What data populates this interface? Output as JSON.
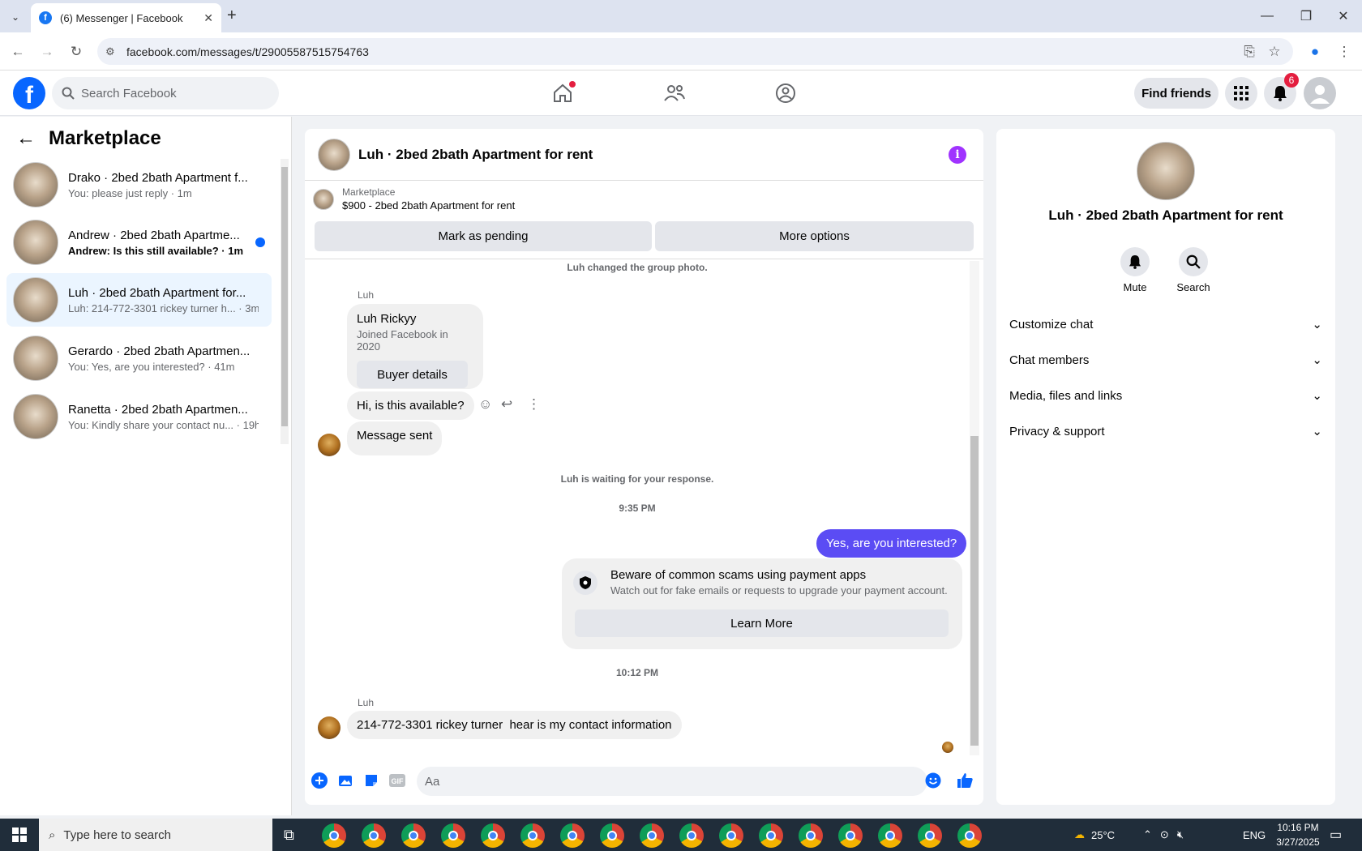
{
  "browser": {
    "tab_title": "(6) Messenger | Facebook",
    "url": "facebook.com/messages/t/29005587515754763"
  },
  "header": {
    "search_placeholder": "Search Facebook",
    "find_friends": "Find friends",
    "notification_count": "6"
  },
  "sidebar": {
    "title": "Marketplace",
    "conversations": [
      {
        "name": "Drako · 2bed 2bath Apartment f...",
        "preview": "You: please just reply · 1m",
        "unread": false
      },
      {
        "name": "Andrew · 2bed 2bath Apartme...",
        "preview": "Andrew: Is this still available? · 1m",
        "unread": true
      },
      {
        "name": "Luh · 2bed 2bath Apartment for...",
        "preview": "Luh: 214-772-3301 rickey turner h... · 3m",
        "unread": false
      },
      {
        "name": "Gerardo · 2bed 2bath Apartmen...",
        "preview": "You: Yes, are you interested? · 41m",
        "unread": false
      },
      {
        "name": "Ranetta · 2bed 2bath Apartmen...",
        "preview": "You: Kindly share your contact nu... · 19h",
        "unread": false
      }
    ]
  },
  "chat": {
    "title": "Luh · 2bed 2bath Apartment for rent",
    "marketplace_label": "Marketplace",
    "listing": "$900 - 2bed 2bath Apartment for rent",
    "mark_pending": "Mark as pending",
    "more_options": "More options",
    "sys_group_photo": "Luh changed the group photo.",
    "sender_name": "Luh",
    "buyer_name": "Luh Rickyy",
    "buyer_joined": "Joined Facebook in 2020",
    "buyer_details": "Buyer details",
    "msg_available": "Hi, is this available?",
    "msg_sent": "Message sent",
    "sys_waiting": "Luh is waiting for your response.",
    "time1": "9:35 PM",
    "outgoing": "Yes, are you interested?",
    "scam_title": "Beware of common scams using payment apps",
    "scam_sub": "Watch out for fake emails or requests to upgrade your payment account.",
    "learn_more": "Learn More",
    "time2": "10:12 PM",
    "msg_contact": "214-772-3301 rickey turner  hear is my contact information",
    "input_placeholder": "Aa"
  },
  "right_panel": {
    "title": "Luh · 2bed 2bath Apartment for rent",
    "mute": "Mute",
    "search": "Search",
    "sections": [
      "Customize chat",
      "Chat members",
      "Media, files and links",
      "Privacy & support"
    ]
  },
  "taskbar": {
    "search_placeholder": "Type here to search",
    "weather": "25°C",
    "lang": "ENG",
    "time": "10:16 PM",
    "date": "3/27/2025"
  }
}
